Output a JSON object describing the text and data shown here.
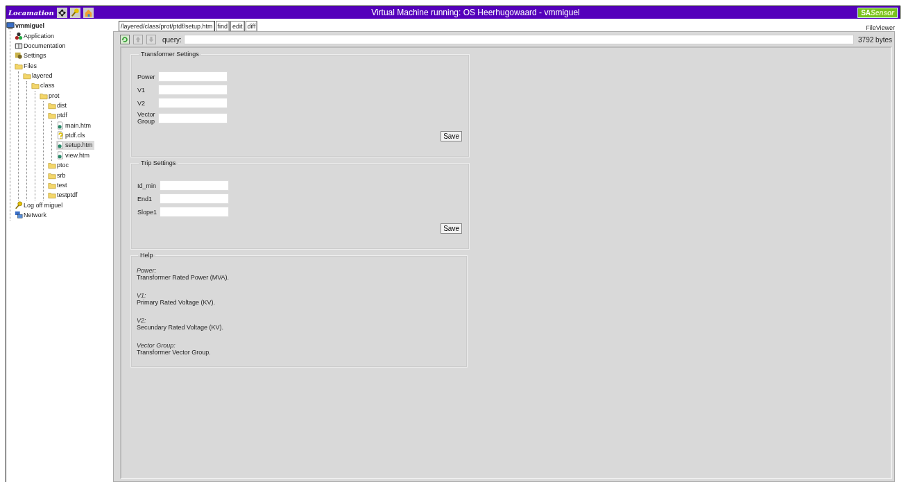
{
  "header": {
    "logo": "Locamation",
    "title": "Virtual Machine running: OS Heerhugowaard - vmmiguel",
    "badge": {
      "prefix": "SA",
      "suffix": "Sensor"
    }
  },
  "sidebar": {
    "tree": [
      {
        "label": "vmmiguel",
        "kind": "computer",
        "selected": false,
        "children": [
          {
            "label": "Application",
            "kind": "app",
            "selected": false
          },
          {
            "label": "Documentation",
            "kind": "book",
            "selected": false
          },
          {
            "label": "Settings",
            "kind": "settings",
            "selected": false
          },
          {
            "label": "Files",
            "kind": "folder",
            "selected": false,
            "children": [
              {
                "label": "layered",
                "kind": "folder",
                "selected": false,
                "children": [
                  {
                    "label": "class",
                    "kind": "folder",
                    "selected": false,
                    "children": [
                      {
                        "label": "prot",
                        "kind": "folder",
                        "selected": false,
                        "children": [
                          {
                            "label": "dist",
                            "kind": "folder",
                            "selected": false
                          },
                          {
                            "label": "ptdf",
                            "kind": "folder",
                            "selected": false,
                            "children": [
                              {
                                "label": "main.htm",
                                "kind": "file",
                                "selected": false
                              },
                              {
                                "label": "ptdf.cls",
                                "kind": "unknown",
                                "selected": false
                              },
                              {
                                "label": "setup.htm",
                                "kind": "file",
                                "selected": true
                              },
                              {
                                "label": "view.htm",
                                "kind": "file",
                                "selected": false
                              }
                            ]
                          },
                          {
                            "label": "ptoc",
                            "kind": "folder",
                            "selected": false
                          },
                          {
                            "label": "srb",
                            "kind": "folder",
                            "selected": false
                          },
                          {
                            "label": "test",
                            "kind": "folder",
                            "selected": false
                          },
                          {
                            "label": "testptdf",
                            "kind": "folder",
                            "selected": false
                          }
                        ]
                      }
                    ]
                  }
                ]
              }
            ]
          },
          {
            "label": "Log off miguel",
            "kind": "key",
            "selected": false
          },
          {
            "label": "Network",
            "kind": "network",
            "selected": false
          }
        ]
      }
    ]
  },
  "viewer": {
    "tabs": [
      {
        "label": "/layered/class/prot/ptdf/setup.htm",
        "selected": true
      },
      {
        "label": "find",
        "selected": false
      },
      {
        "label": "edit",
        "selected": false
      },
      {
        "label": "diff",
        "selected": false
      }
    ],
    "title": "FileViewer",
    "toolbar": {
      "buttons": [
        {
          "kind": "refresh",
          "disabled": false
        },
        {
          "kind": "up",
          "disabled": true
        },
        {
          "kind": "down",
          "disabled": true
        }
      ],
      "query_label": "query:",
      "size": "3792 bytes"
    },
    "sections": [
      {
        "kind": "form",
        "legend": "Transformer Settings",
        "fields": [
          {
            "label": "Power"
          },
          {
            "label": "V1"
          },
          {
            "label": "V2"
          },
          {
            "label": "Vector Group"
          }
        ],
        "button": "Save"
      },
      {
        "kind": "form",
        "legend": "Trip Settings",
        "fields": [
          {
            "label": "Id_min"
          },
          {
            "label": "End1"
          },
          {
            "label": "Slope1"
          }
        ],
        "button": "Save"
      },
      {
        "kind": "help",
        "legend": "Help",
        "items": [
          {
            "term": "Power:",
            "text": "Transformer Rated Power (MVA)."
          },
          {
            "term": "V1:",
            "text": "Primary Rated Voltage (KV)."
          },
          {
            "term": "V2:",
            "text": "Secundary Rated Voltage (KV)."
          },
          {
            "term": "Vector Group:",
            "text": "Transformer Vector Group."
          }
        ]
      }
    ]
  }
}
